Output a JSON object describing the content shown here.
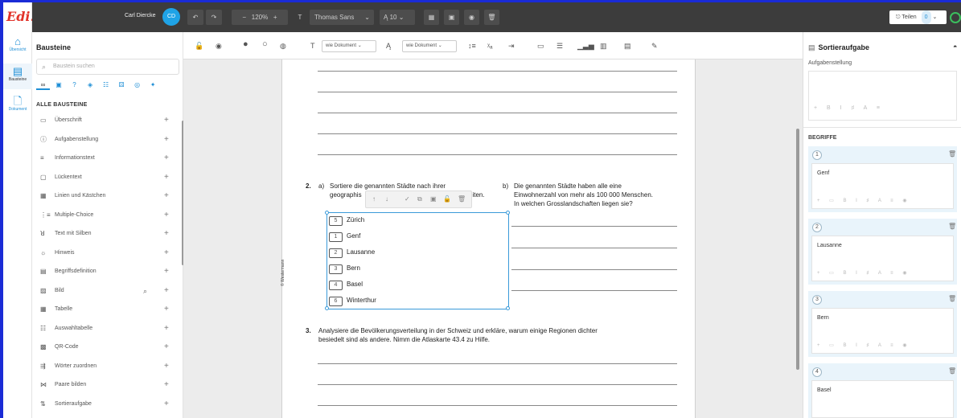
{
  "app": {
    "logo": "Edi."
  },
  "rail": [
    {
      "label": "Übersicht",
      "icon": "home-icon"
    },
    {
      "label": "Bausteine",
      "icon": "blocks-icon"
    },
    {
      "label": "Dokument",
      "icon": "document-icon"
    }
  ],
  "topbar": {
    "user": "Carl Diercke",
    "avatar": "CD",
    "zoom": "120%",
    "font": "Thomas Sans",
    "font_size": "10",
    "share_label": "Teilen",
    "share_count": "0"
  },
  "panel": {
    "title": "Bausteine",
    "search_placeholder": "Baustein suchen",
    "section": "ALLE BAUSTEINE",
    "blocks": [
      {
        "label": "Überschrift",
        "icon": "heading-icon"
      },
      {
        "label": "Aufgabenstellung",
        "icon": "question-icon"
      },
      {
        "label": "Informationstext",
        "icon": "text-icon"
      },
      {
        "label": "Lückentext",
        "icon": "gap-text-icon"
      },
      {
        "label": "Linien und Kästchen",
        "icon": "lines-icon"
      },
      {
        "label": "Multiple-Choice",
        "icon": "list-icon"
      },
      {
        "label": "Text mit Silben",
        "icon": "syllable-icon"
      },
      {
        "label": "Hinweis",
        "icon": "hint-icon"
      },
      {
        "label": "Begriffsdefinition",
        "icon": "definition-icon"
      },
      {
        "label": "Bild",
        "icon": "image-icon"
      },
      {
        "label": "Tabelle",
        "icon": "table-icon"
      },
      {
        "label": "Auswahltabelle",
        "icon": "selection-table-icon"
      },
      {
        "label": "QR-Code",
        "icon": "qr-icon"
      },
      {
        "label": "Wörter zuordnen",
        "icon": "match-words-icon"
      },
      {
        "label": "Paare bilden",
        "icon": "pairs-icon"
      },
      {
        "label": "Sortieraufgabe",
        "icon": "sort-icon"
      }
    ]
  },
  "format": {
    "style_select": "wie Dokument",
    "size_select": "wie Dokument"
  },
  "document": {
    "q2_num": "2.",
    "q2a_label": "a)",
    "q2a_line1": "Sortiere die genannten Städte  nach ihrer",
    "q2a_line2_start": "geographis",
    "q2a_line2_end": "eiten.",
    "q2b_label": "b)",
    "q2b_line1": "Die genannten Städte haben alle eine",
    "q2b_line2": "Einwohnerzahl von mehr als 100 000 Menschen.",
    "q2b_line3": "In welchen Grosslandschaften liegen sie?",
    "watermark": "© Westermann",
    "sort_items": [
      {
        "num": "5",
        "city": "Zürich"
      },
      {
        "num": "1",
        "city": "Genf"
      },
      {
        "num": "2",
        "city": "Lausanne"
      },
      {
        "num": "3",
        "city": "Bern"
      },
      {
        "num": "4",
        "city": "Basel"
      },
      {
        "num": "6",
        "city": "Winterthur"
      }
    ],
    "q3_num": "3.",
    "q3_line1": "Analysiere die Bevölkerungsverteilung in der Schweiz und erkläre, warum einige Regionen dichter",
    "q3_line2": "besiedelt sind als andere. Nimm die Atlaskarte 43.4 zu Hilfe."
  },
  "rpanel": {
    "title": "Sortieraufgabe",
    "task_label": "Aufgabenstellung",
    "terms_label": "BEGRIFFE",
    "terms": [
      {
        "num": "1",
        "value": "Genf"
      },
      {
        "num": "2",
        "value": "Lausanne"
      },
      {
        "num": "3",
        "value": "Bern"
      },
      {
        "num": "4",
        "value": "Basel"
      }
    ]
  }
}
